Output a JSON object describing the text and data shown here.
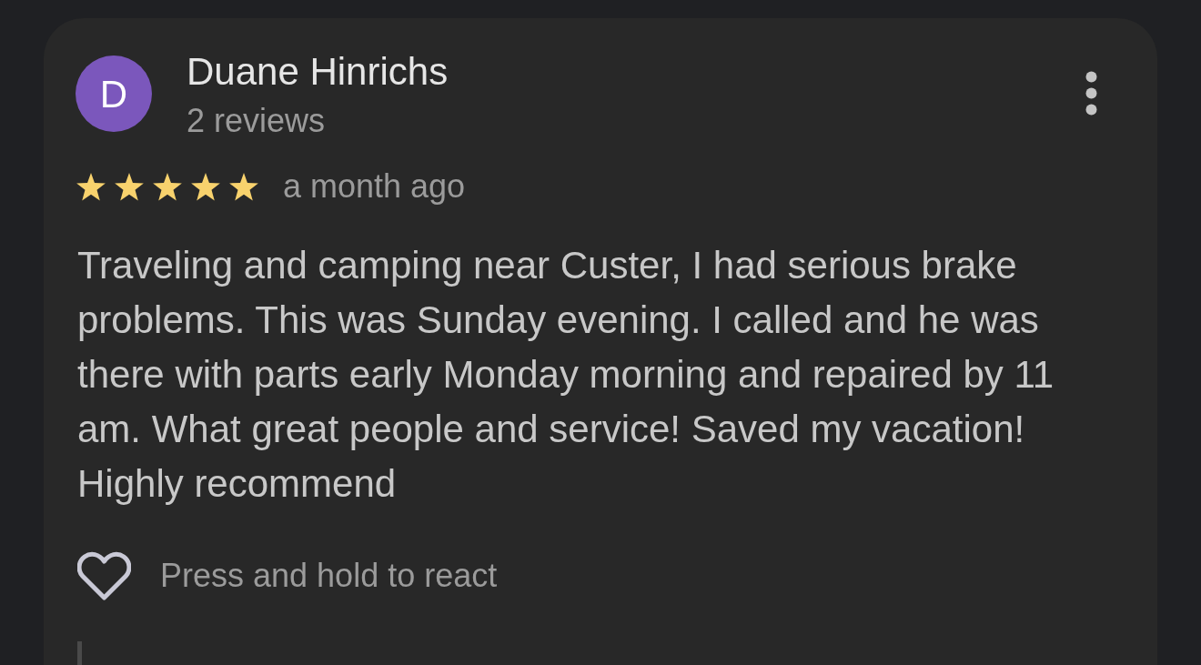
{
  "review": {
    "author": {
      "initial": "D",
      "name": "Duane Hinrichs",
      "review_count": "2 reviews"
    },
    "stars": 5,
    "time": "a month ago",
    "text": "Traveling and camping near Custer, I had serious brake problems. This was Sunday evening. I called and he was there with parts early Monday morning and repaired by 11 am. What great people and service! Saved my vacation! Highly recommend",
    "reaction_hint": "Press and hold to react"
  }
}
